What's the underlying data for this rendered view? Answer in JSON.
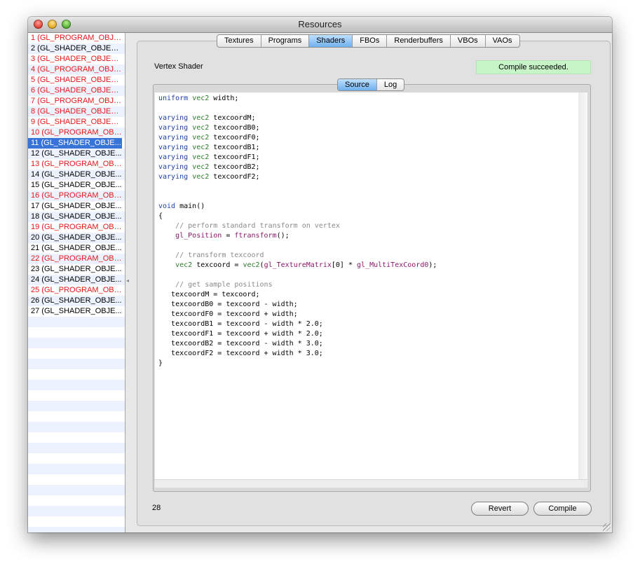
{
  "window": {
    "title": "Resources"
  },
  "resources": [
    {
      "label": "1 (GL_PROGRAM_OBJE...",
      "kind": "program"
    },
    {
      "label": "2 (GL_SHADER_OBJEC...",
      "kind": "shader"
    },
    {
      "label": "3 (GL_SHADER_OBJEC...",
      "kind": "program"
    },
    {
      "label": "4 (GL_PROGRAM_OBJE...",
      "kind": "program"
    },
    {
      "label": "5 (GL_SHADER_OBJEC...",
      "kind": "program"
    },
    {
      "label": "6 (GL_SHADER_OBJEC...",
      "kind": "program"
    },
    {
      "label": "7 (GL_PROGRAM_OBJE...",
      "kind": "program"
    },
    {
      "label": "8 (GL_SHADER_OBJEC...",
      "kind": "program"
    },
    {
      "label": "9 (GL_SHADER_OBJEC...",
      "kind": "program"
    },
    {
      "label": "10 (GL_PROGRAM_OBJ...",
      "kind": "program"
    },
    {
      "label": "11 (GL_SHADER_OBJE...",
      "kind": "shader",
      "selected": true
    },
    {
      "label": "12 (GL_SHADER_OBJE...",
      "kind": "shader"
    },
    {
      "label": "13 (GL_PROGRAM_OBJ...",
      "kind": "program"
    },
    {
      "label": "14 (GL_SHADER_OBJE...",
      "kind": "shader"
    },
    {
      "label": "15 (GL_SHADER_OBJE...",
      "kind": "shader"
    },
    {
      "label": "16 (GL_PROGRAM_OBJ...",
      "kind": "program"
    },
    {
      "label": "17 (GL_SHADER_OBJE...",
      "kind": "shader"
    },
    {
      "label": "18 (GL_SHADER_OBJE...",
      "kind": "shader"
    },
    {
      "label": "19 (GL_PROGRAM_OBJ...",
      "kind": "program"
    },
    {
      "label": "20 (GL_SHADER_OBJE...",
      "kind": "shader"
    },
    {
      "label": "21 (GL_SHADER_OBJE...",
      "kind": "shader"
    },
    {
      "label": "22 (GL_PROGRAM_OBJ...",
      "kind": "program"
    },
    {
      "label": "23 (GL_SHADER_OBJE...",
      "kind": "shader"
    },
    {
      "label": "24 (GL_SHADER_OBJE...",
      "kind": "shader"
    },
    {
      "label": "25 (GL_PROGRAM_OBJ...",
      "kind": "program"
    },
    {
      "label": "26 (GL_SHADER_OBJE...",
      "kind": "shader"
    },
    {
      "label": "27 (GL_SHADER_OBJE...",
      "kind": "shader"
    }
  ],
  "tabs": [
    {
      "label": "Textures",
      "active": false
    },
    {
      "label": "Programs",
      "active": false
    },
    {
      "label": "Shaders",
      "active": true
    },
    {
      "label": "FBOs",
      "active": false
    },
    {
      "label": "Renderbuffers",
      "active": false
    },
    {
      "label": "VBOs",
      "active": false
    },
    {
      "label": "VAOs",
      "active": false
    }
  ],
  "shader": {
    "type_label": "Vertex Shader",
    "status": "Compile succeeded.",
    "line_count": "28"
  },
  "subtabs": [
    {
      "label": "Source",
      "active": true
    },
    {
      "label": "Log",
      "active": false
    }
  ],
  "code_lines": [
    [
      [
        "kw",
        "uniform"
      ],
      [
        "t",
        " "
      ],
      [
        "ty",
        "vec2"
      ],
      [
        "t",
        " width;"
      ]
    ],
    [],
    [
      [
        "kw",
        "varying"
      ],
      [
        "t",
        " "
      ],
      [
        "ty",
        "vec2"
      ],
      [
        "t",
        " texcoordM;"
      ]
    ],
    [
      [
        "kw",
        "varying"
      ],
      [
        "t",
        " "
      ],
      [
        "ty",
        "vec2"
      ],
      [
        "t",
        " texcoordB0;"
      ]
    ],
    [
      [
        "kw",
        "varying"
      ],
      [
        "t",
        " "
      ],
      [
        "ty",
        "vec2"
      ],
      [
        "t",
        " texcoordF0;"
      ]
    ],
    [
      [
        "kw",
        "varying"
      ],
      [
        "t",
        " "
      ],
      [
        "ty",
        "vec2"
      ],
      [
        "t",
        " texcoordB1;"
      ]
    ],
    [
      [
        "kw",
        "varying"
      ],
      [
        "t",
        " "
      ],
      [
        "ty",
        "vec2"
      ],
      [
        "t",
        " texcoordF1;"
      ]
    ],
    [
      [
        "kw",
        "varying"
      ],
      [
        "t",
        " "
      ],
      [
        "ty",
        "vec2"
      ],
      [
        "t",
        " texcoordB2;"
      ]
    ],
    [
      [
        "kw",
        "varying"
      ],
      [
        "t",
        " "
      ],
      [
        "ty",
        "vec2"
      ],
      [
        "t",
        " texcoordF2;"
      ]
    ],
    [],
    [],
    [
      [
        "kw",
        "void"
      ],
      [
        "t",
        " main()"
      ]
    ],
    [
      [
        "t",
        "{"
      ]
    ],
    [
      [
        "t",
        "    "
      ],
      [
        "cm",
        "// perform standard transform on vertex"
      ]
    ],
    [
      [
        "t",
        "    "
      ],
      [
        "bi",
        "gl_Position"
      ],
      [
        "t",
        " = "
      ],
      [
        "bi",
        "ftransform"
      ],
      [
        "t",
        "();"
      ]
    ],
    [],
    [
      [
        "t",
        "    "
      ],
      [
        "cm",
        "// transform texcoord"
      ]
    ],
    [
      [
        "t",
        "    "
      ],
      [
        "ty",
        "vec2"
      ],
      [
        "t",
        " texcoord = "
      ],
      [
        "ty",
        "vec2"
      ],
      [
        "t",
        "("
      ],
      [
        "bi",
        "gl_TextureMatrix"
      ],
      [
        "t",
        "[0] * "
      ],
      [
        "bi",
        "gl_MultiTexCoord0"
      ],
      [
        "t",
        ");"
      ]
    ],
    [],
    [
      [
        "t",
        "    "
      ],
      [
        "cm",
        "// get sample positions"
      ]
    ],
    [
      [
        "t",
        "   texcoordM = texcoord;"
      ]
    ],
    [
      [
        "t",
        "   texcoordB0 = texcoord - width;"
      ]
    ],
    [
      [
        "t",
        "   texcoordF0 = texcoord + width;"
      ]
    ],
    [
      [
        "t",
        "   texcoordB1 = texcoord - width * 2.0;"
      ]
    ],
    [
      [
        "t",
        "   texcoordF1 = texcoord + width * 2.0;"
      ]
    ],
    [
      [
        "t",
        "   texcoordB2 = texcoord - width * 3.0;"
      ]
    ],
    [
      [
        "t",
        "   texcoordF2 = texcoord + width * 3.0;"
      ]
    ],
    [
      [
        "t",
        "}"
      ]
    ]
  ],
  "buttons": {
    "revert": "Revert",
    "compile": "Compile"
  },
  "colors": {
    "program_item": "#e41818",
    "selection": "#3874d8",
    "status_bg": "#c8f5c8",
    "active_tab": "#6fb0ef"
  }
}
